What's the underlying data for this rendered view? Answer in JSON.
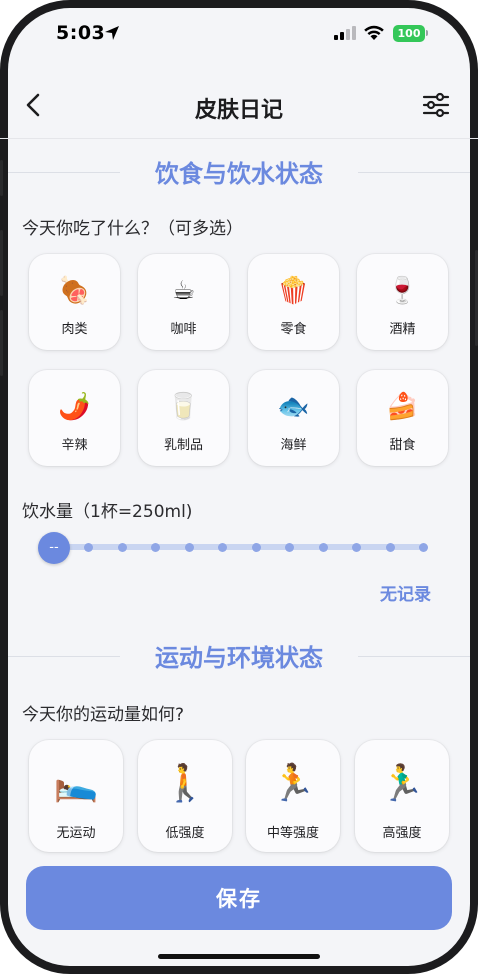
{
  "status_bar": {
    "time": "5:03",
    "battery": "100"
  },
  "nav": {
    "title": "皮肤日记",
    "back_icon": "chevron-left-icon",
    "filter_icon": "sliders-icon"
  },
  "diet_section": {
    "title": "饮食与饮水状态",
    "question": "今天你吃了什么？（可多选）",
    "foods": [
      {
        "label": "肉类",
        "emoji": "🍖"
      },
      {
        "label": "咖啡",
        "emoji": "☕"
      },
      {
        "label": "零食",
        "emoji": "🍿"
      },
      {
        "label": "酒精",
        "emoji": "🍷"
      },
      {
        "label": "辛辣",
        "emoji": "🌶️"
      },
      {
        "label": "乳制品",
        "emoji": "🥛"
      },
      {
        "label": "海鲜",
        "emoji": "🐟"
      },
      {
        "label": "甜食",
        "emoji": "🍰"
      }
    ],
    "water_label": "饮水量（1杯=250ml)",
    "water_slider": {
      "value_display": "--",
      "steps": 12,
      "current_step": 0
    },
    "water_status": "无记录"
  },
  "exercise_section": {
    "title": "运动与环境状态",
    "question": "今天你的运动量如何?",
    "options": [
      {
        "label": "无运动",
        "emoji": "🛌"
      },
      {
        "label": "低强度",
        "emoji": "🚶"
      },
      {
        "label": "中等强度",
        "emoji": "🏃"
      },
      {
        "label": "高强度",
        "emoji": "🏃‍♂️"
      }
    ]
  },
  "save_button": {
    "label": "保存"
  },
  "colors": {
    "accent": "#6b89df",
    "track": "#c9d5f1",
    "background": "#f4f5f8",
    "battery": "#34c759"
  }
}
